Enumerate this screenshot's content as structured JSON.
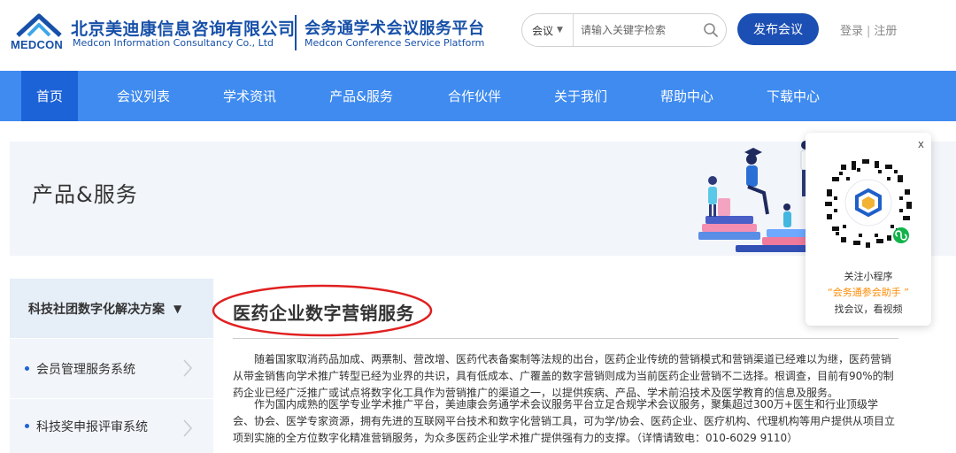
{
  "header": {
    "logo_text": "MEDCON",
    "company_cn": "北京美迪康信息咨询有限公司",
    "company_en": "Medcon Information Consultancy Co., Ltd",
    "platform_cn": "会务通学术会议服务平台",
    "platform_en": "Medcon Conference Service Platform",
    "search": {
      "category": "会议",
      "placeholder": "请输入关键字检索"
    },
    "publish_label": "发布会议",
    "login_label": "登录",
    "login_separator": "|",
    "register_label": "注册"
  },
  "nav": {
    "items": [
      {
        "label": "首页"
      },
      {
        "label": "会议列表"
      },
      {
        "label": "学术资讯"
      },
      {
        "label": "产品&服务"
      },
      {
        "label": "合作伙伴"
      },
      {
        "label": "关于我们"
      },
      {
        "label": "帮助中心"
      },
      {
        "label": "下载中心"
      }
    ]
  },
  "banner": {
    "title": "产品&服务"
  },
  "qr": {
    "close": "x",
    "line1": "关注小程序",
    "line2": "“会务通参会助手 ”",
    "line3": "找会议，看视频"
  },
  "sidebar": {
    "header": "科技社团数字化解决方案",
    "items": [
      {
        "label": "会员管理服务系统"
      },
      {
        "label": "科技奖申报评审系统"
      }
    ]
  },
  "main": {
    "title": "医药企业数字营销服务",
    "para1": "随着国家取消药品加成、两票制、营改增、医药代表备案制等法规的出台，医药企业传统的营销模式和营销渠道已经难以为继，医药营销从带金销售向学术推广转型已经为业界的共识，具有低成本、广覆盖的数字营销则成为当前医药企业营销不二选择。根调查，目前有90%的制药企业已经广泛推广或试点将数字化工具作为营销推广的渠道之一，以提供疾病、产品、学术前沿技术及医学教育的信息及服务。",
    "para2": "作为国内成熟的医学专业学术推广平台，美迪康会务通学术会议服务平台立足合规学术会议服务，聚集超过300万+医生和行业顶级学会、协会、医学专家资源，拥有先进的互联网平台技术和数字化营销工具，可为学/协会、医药企业、医疗机构、代理机构等用户提供从项目立项到实施的全方位数字化精准营销服务，为众多医药企业学术推广提供强有力的支撑。（详情请致电：010-6029 9110）"
  },
  "colors": {
    "brand": "#1750a8",
    "nav_bg": "#3f8bf0",
    "nav_active": "#1d63d8",
    "publish_button": "#1c4fb3",
    "highlight_ellipse": "#e02020",
    "qr_accent": "#ff8a00"
  }
}
